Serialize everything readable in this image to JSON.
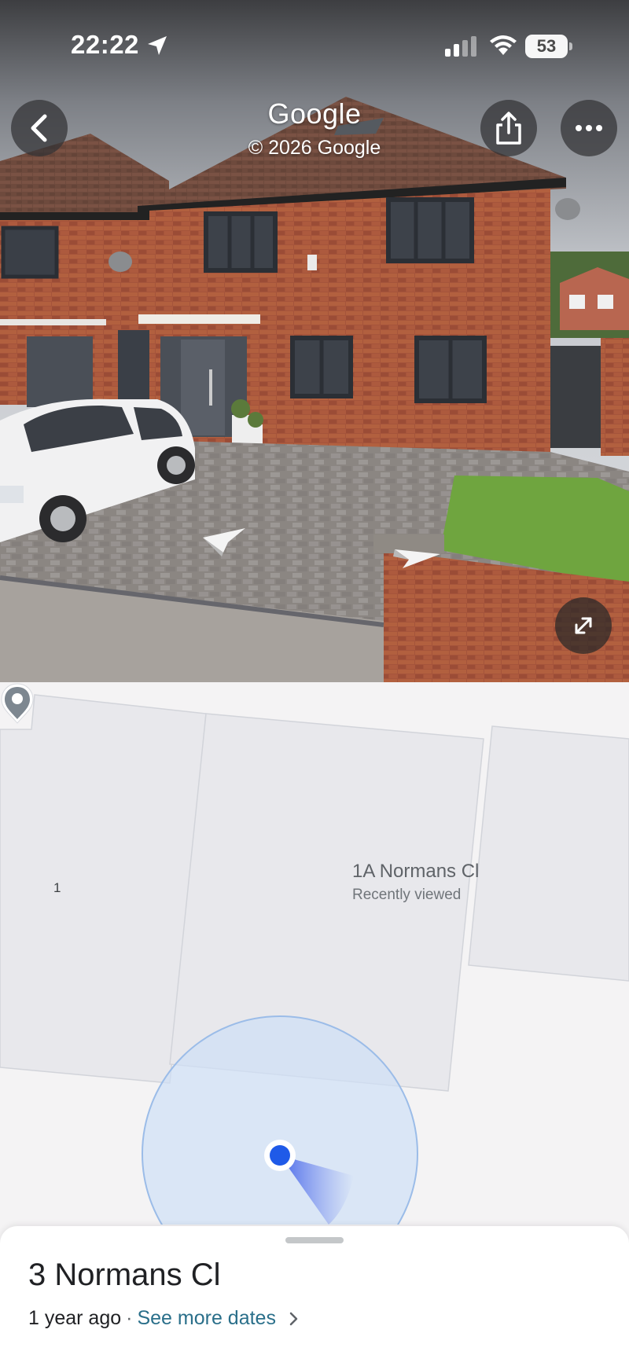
{
  "status_bar": {
    "time": "22:22",
    "battery_level": "53",
    "icons": [
      "location-arrow-icon",
      "cellular-signal-icon",
      "wifi-icon",
      "battery-icon"
    ]
  },
  "street_view": {
    "brand": "Google",
    "copyright": "© 2026 Google",
    "buttons": {
      "back": "chevron-left-icon",
      "share": "share-icon",
      "more": "ellipsis-icon",
      "expand": "expand-icon"
    },
    "navigation_arrows": [
      "nav-arrow-left-icon",
      "nav-arrow-right-icon"
    ]
  },
  "map": {
    "house_number": "1",
    "place": {
      "title": "1A Normans Cl",
      "subtitle": "Recently viewed"
    },
    "colors": {
      "background": "#f4f3f4",
      "building": "#e8e8ec",
      "accuracy_circle": "#cfe0f7",
      "user_dot": "#1f5ae8"
    }
  },
  "sheet": {
    "title": "3 Normans Cl",
    "age": "1 year ago",
    "separator": "·",
    "more_dates_label": "See more dates"
  }
}
